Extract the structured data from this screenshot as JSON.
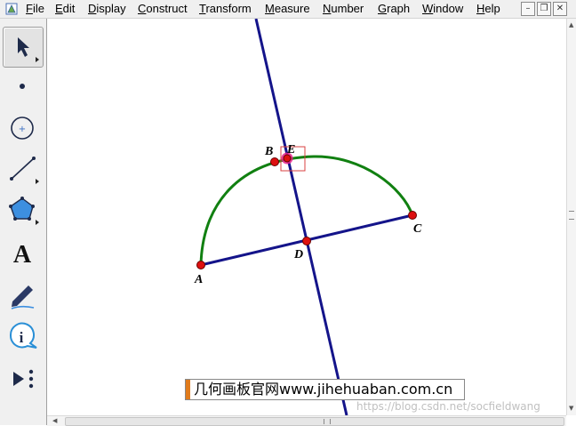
{
  "menubar": {
    "items": [
      {
        "underline": "F",
        "rest": "ile"
      },
      {
        "underline": "E",
        "rest": "dit"
      },
      {
        "underline": "D",
        "rest": "isplay"
      },
      {
        "underline": "C",
        "rest": "onstruct"
      },
      {
        "underline": "T",
        "rest": "ransform"
      },
      {
        "underline": "M",
        "rest": "easure"
      },
      {
        "underline": "N",
        "rest": "umber"
      },
      {
        "underline": "G",
        "rest": "raph"
      },
      {
        "underline": "W",
        "rest": "indow"
      },
      {
        "underline": "H",
        "rest": "elp"
      }
    ],
    "window_controls": [
      "minimize-icon",
      "restore-icon",
      "close-icon"
    ]
  },
  "toolbar": {
    "tools": [
      {
        "name": "arrow-select-icon",
        "selected": true
      },
      {
        "name": "point-tool-icon"
      },
      {
        "name": "compass-tool-icon"
      },
      {
        "name": "straightedge-tool-icon"
      },
      {
        "name": "polygon-tool-icon"
      },
      {
        "name": "text-tool-icon",
        "glyph": "A"
      },
      {
        "name": "marker-tool-icon"
      },
      {
        "name": "information-tool-icon",
        "glyph": "i"
      },
      {
        "name": "custom-tool-icon"
      }
    ]
  },
  "sketch": {
    "points": {
      "A": "A",
      "B": "B",
      "C": "C",
      "D": "D",
      "E": "E"
    },
    "colors": {
      "arc": "#118011",
      "line": "#14148a",
      "point": "#dd1010",
      "selection": "#e8208c"
    }
  },
  "banner": {
    "text": "几何画板官网www.jihehuaban.com.cn"
  },
  "watermark": {
    "text": "https://blog.csdn.net/socfieldwang"
  }
}
